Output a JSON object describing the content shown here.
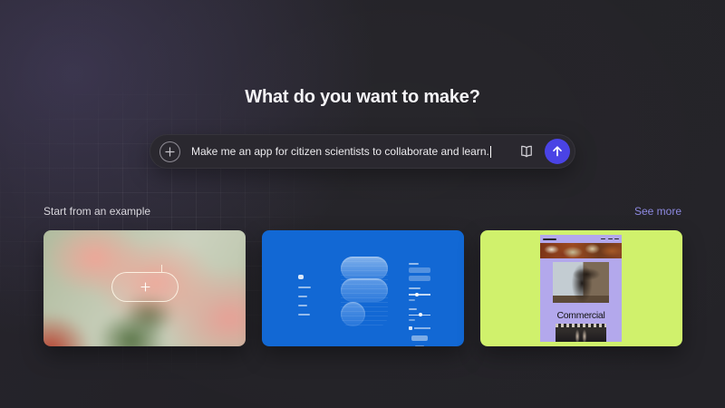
{
  "app": {
    "heading": "What do you want to make?"
  },
  "prompt_bar": {
    "value": "Make me an app for citizen scientists to collaborate and learn.",
    "submit_color": "#4a43e5",
    "icons": [
      "plus-icon",
      "open-book-icon",
      "arrow-up-icon"
    ]
  },
  "examples": {
    "label": "Start from an example",
    "see_more": "See more",
    "see_more_color": "#8d89e0",
    "cards": [
      {
        "name": "flower-photo-template"
      },
      {
        "name": "blue-3d-editor-template",
        "bg": "#1268d4"
      },
      {
        "name": "portfolio-site-template",
        "bg": "#d0f16c",
        "mockup_bg": "#b3a8ec",
        "mockup_title": "Commercial"
      }
    ]
  }
}
